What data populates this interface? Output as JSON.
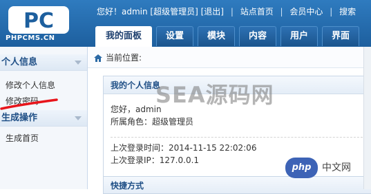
{
  "logo": {
    "mark": "PC",
    "site": "PHPCMS.CN"
  },
  "topbar": {
    "greeting": "您好！admin [超级管理员]",
    "logout": "[退出]",
    "home": "站点首页",
    "member": "会员中心",
    "search": "搜索"
  },
  "tabs": [
    "我的面板",
    "设置",
    "模块",
    "内容",
    "用户",
    "界面"
  ],
  "sidebar": {
    "section1": "个人信息",
    "items1": [
      "修改个人信息",
      "修改密码"
    ],
    "section2": "生成操作",
    "items2": [
      "生成首页"
    ]
  },
  "breadcrumb": "当前位置:",
  "panel": {
    "title": "我的个人信息",
    "hello": "您好，admin",
    "role": "所属角色：超级管理员",
    "last_login_time": "上次登录时间：2014-11-15 22:02:06",
    "last_login_ip": "上次登录IP：127.0.0.1"
  },
  "panel2": {
    "title": "快捷方式"
  },
  "watermark": "SEA源码网",
  "php_badge": {
    "badge": "php",
    "text": "中文网"
  },
  "colors": {
    "header": "#1d5f9e",
    "accent": "#1f4f86",
    "annotation": "#e8151b"
  }
}
